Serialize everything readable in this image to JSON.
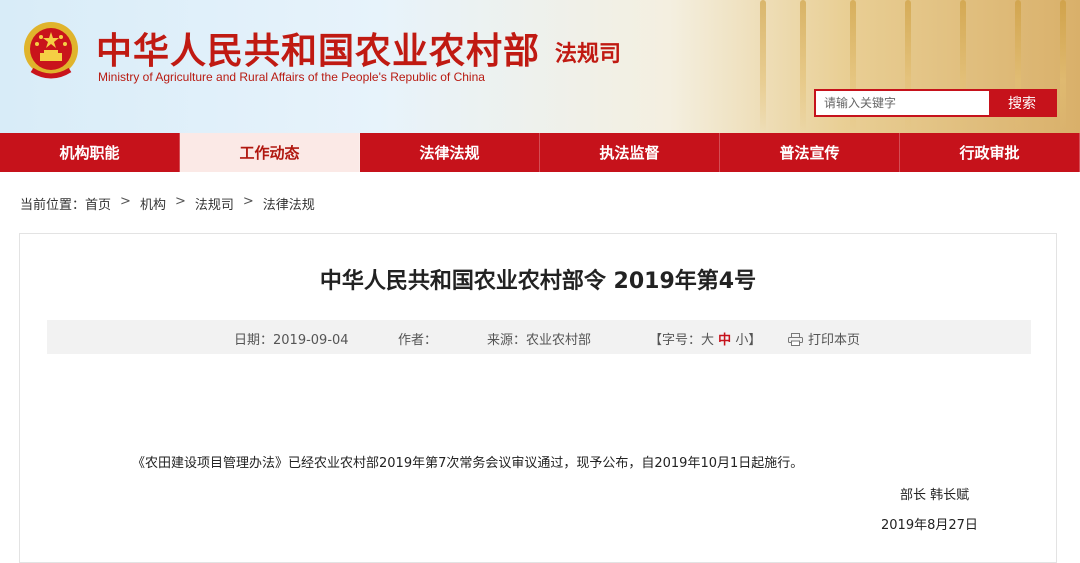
{
  "header": {
    "title_cn": "中华人民共和国农业农村部",
    "title_en": "Ministry of Agriculture and Rural Affairs of the People's Republic of China",
    "department": "法规司",
    "search": {
      "placeholder": "请输入关键字",
      "button": "搜索"
    }
  },
  "nav": {
    "items": [
      "机构职能",
      "工作动态",
      "法律法规",
      "执法监督",
      "普法宣传",
      "行政审批"
    ],
    "active_index": 2
  },
  "breadcrumb": {
    "label": "当前位置：",
    "items": [
      "首页",
      "机构",
      "法规司",
      "法律法规"
    ],
    "separator": ">"
  },
  "article": {
    "title": "中华人民共和国农业农村部令 2019年第4号",
    "meta": {
      "date": "日期：2019-09-04",
      "author": "作者：",
      "source": "来源：农业农村部",
      "font_size_label": "【字号：",
      "font_sizes": [
        "大",
        "中",
        "小"
      ],
      "font_size_close": "】",
      "print": "打印本页"
    },
    "body": "《农田建设项目管理办法》已经农业农村部2019年第7次常务会议审议通过，现予公布，自2019年10月1日起施行。",
    "signature": {
      "title": "部长  韩长赋",
      "date": "2019年8月27日"
    }
  },
  "colors": {
    "brand_red": "#c6121b",
    "active_tab_bg": "#fbe9e6"
  }
}
